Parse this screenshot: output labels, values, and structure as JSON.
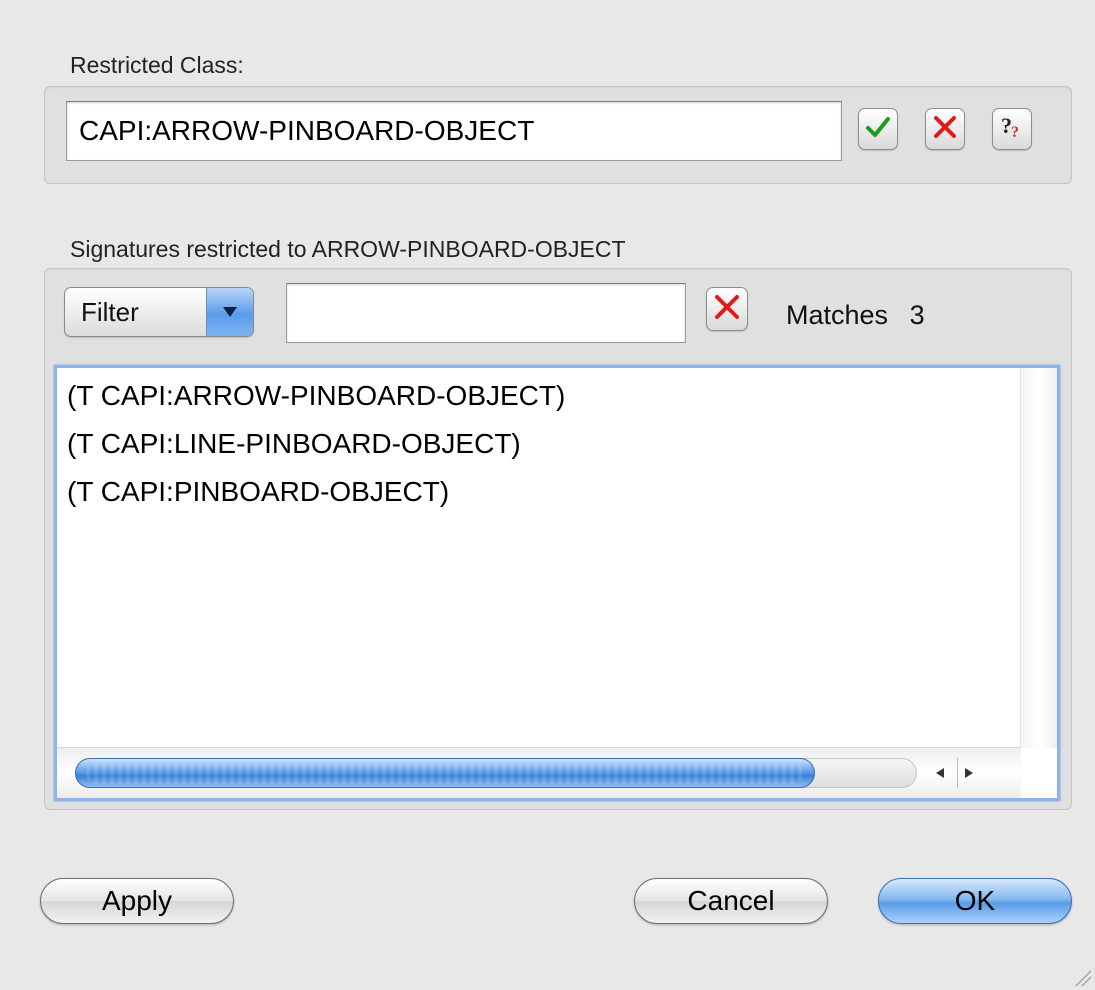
{
  "restricted_class": {
    "label": "Restricted Class:",
    "value": "CAPI:ARROW-PINBOARD-OBJECT",
    "buttons": [
      {
        "icon": "checkmark-icon"
      },
      {
        "icon": "red-x-icon"
      },
      {
        "icon": "help-question-icon"
      }
    ]
  },
  "signatures": {
    "label": "Signatures restricted to ARROW-PINBOARD-OBJECT",
    "filter": {
      "label": "Filter",
      "input_value": "",
      "clear_icon": "red-x-icon"
    },
    "matches_label": "Matches",
    "matches_count": "3",
    "items": [
      "(T CAPI:ARROW-PINBOARD-OBJECT)",
      "(T CAPI:LINE-PINBOARD-OBJECT)",
      "(T CAPI:PINBOARD-OBJECT)"
    ]
  },
  "footer": {
    "apply_label": "Apply",
    "cancel_label": "Cancel",
    "ok_label": "OK"
  },
  "colors": {
    "accent": "#5b9de8",
    "error_red": "#e01b1b",
    "check_green": "#1e9a1e"
  }
}
